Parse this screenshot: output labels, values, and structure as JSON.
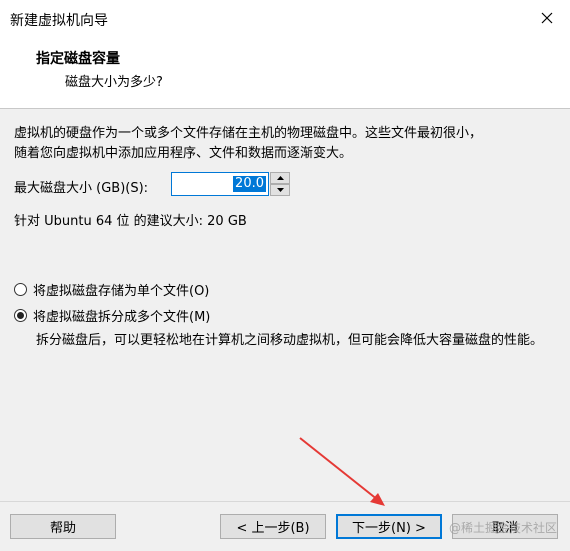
{
  "window": {
    "title": "新建虚拟机向导"
  },
  "header": {
    "title": "指定磁盘容量",
    "subtitle": "磁盘大小为多少?"
  },
  "description": [
    "虚拟机的硬盘作为一个或多个文件存储在主机的物理磁盘中。这些文件最初很小，",
    "随着您向虚拟机中添加应用程序、文件和数据而逐渐变大。"
  ],
  "disk_size": {
    "label": "最大磁盘大小 (GB)(S):",
    "value": "20.0"
  },
  "recommendation": "针对 Ubuntu 64 位 的建议大小: 20 GB",
  "options": {
    "single_file": "将虚拟磁盘存储为单个文件(O)",
    "multiple_files": "将虚拟磁盘拆分成多个文件(M)",
    "selected": "multiple_files"
  },
  "split_description": "拆分磁盘后，可以更轻松地在计算机之间移动虚拟机，但可能会降低大容量磁盘的性能。",
  "buttons": {
    "help": "帮助",
    "back": "< 上一步(B)",
    "next": "下一步(N) >",
    "cancel": "取消"
  },
  "watermark": "@稀土掘金技术社区",
  "colors": {
    "accent": "#0078d7",
    "annotation_arrow": "#e53935"
  }
}
